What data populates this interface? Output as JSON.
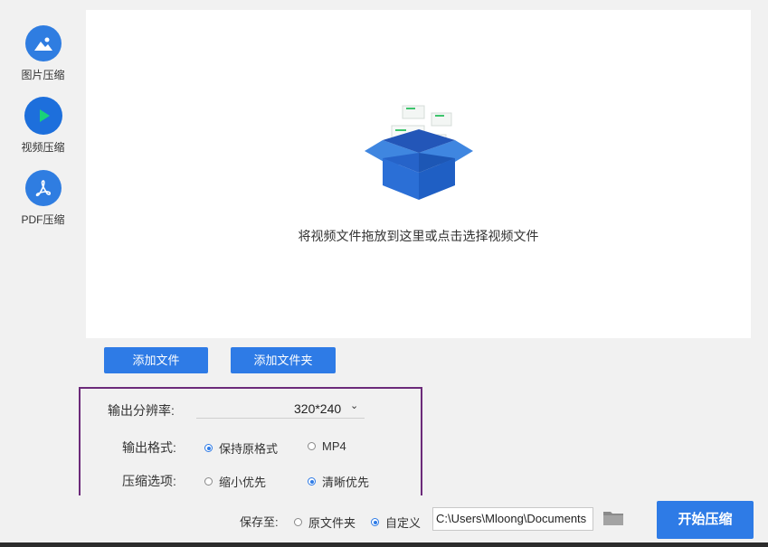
{
  "sidebar": {
    "items": [
      {
        "label": "图片压缩",
        "icon": "image-icon"
      },
      {
        "label": "视频压缩",
        "icon": "play-icon"
      },
      {
        "label": "PDF压缩",
        "icon": "pdf-icon"
      }
    ]
  },
  "drop_zone": {
    "hint": "将视频文件拖放到这里或点击选择视频文件",
    "illustration": "open-box-icon"
  },
  "actions": {
    "add_file": "添加文件",
    "add_folder": "添加文件夹"
  },
  "options": {
    "resolution_label": "输出分辨率:",
    "resolution_value": "320*240",
    "format_label": "输出格式:",
    "format_options": [
      "保持原格式",
      "MP4"
    ],
    "format_selected": "保持原格式",
    "compress_label": "压缩选项:",
    "compress_options": [
      "缩小优先",
      "清晰优先"
    ],
    "compress_selected": "清晰优先"
  },
  "save": {
    "label": "保存至:",
    "options": [
      "原文件夹",
      "自定义"
    ],
    "selected": "自定义",
    "path": "C:\\Users\\Mloong\\Documents"
  },
  "start_button": "开始压缩",
  "colors": {
    "accent": "#2e7be6",
    "highlight_border": "#6c2a7a"
  }
}
